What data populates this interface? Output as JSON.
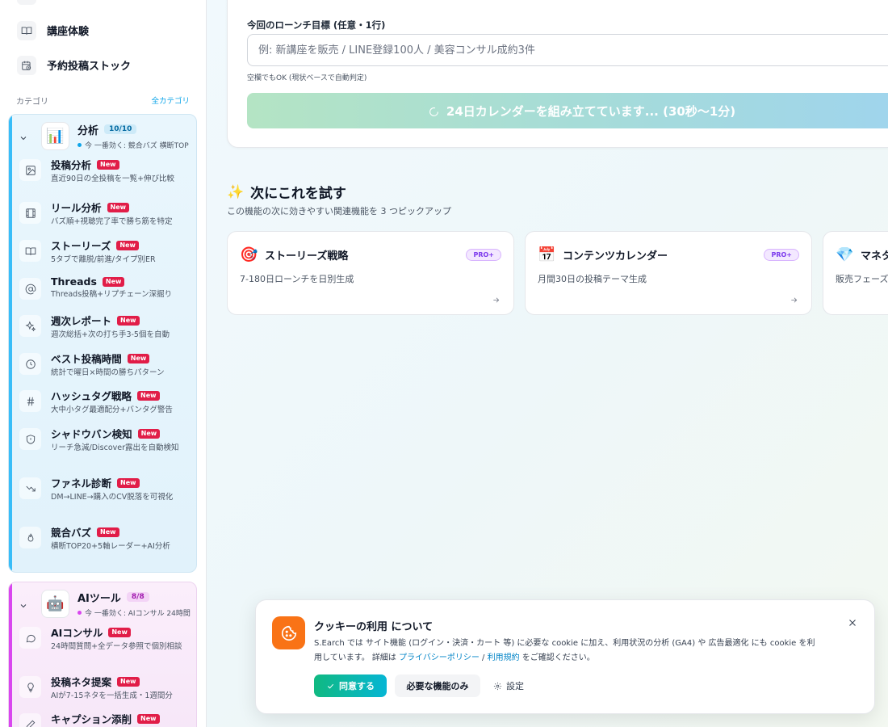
{
  "sidebar": {
    "top_items": [
      {
        "label": "講座体験",
        "icon": "book-open-icon"
      },
      {
        "label": "予約投稿ストック",
        "icon": "calendar-clock-icon"
      }
    ],
    "category_label": "カテゴリ",
    "all_categories_link": "全カテゴリ",
    "groups": [
      {
        "title": "分析",
        "count": "10/10",
        "subtitle": "今 一番効く: 競合バズ 横断TOP",
        "icon": "bar-chart-emoji",
        "accent": "#38bdf8",
        "items": [
          {
            "label": "投稿分析",
            "badge": "New",
            "desc": "直近90日の全投稿を一覧+伸び比較",
            "icon": "image-icon"
          },
          {
            "label": "リール分析",
            "badge": "New",
            "desc": "バズ順+視聴完了率で勝ち筋を特定",
            "icon": "film-icon"
          },
          {
            "label": "ストーリーズ",
            "badge": "New",
            "desc": "5タブで離脱/前進/タイプ別ER",
            "icon": "book-open-icon"
          },
          {
            "label": "Threads",
            "badge": "New",
            "desc": "Threads投稿+リプチェーン深掘り",
            "icon": "at-sign-icon"
          },
          {
            "label": "週次レポート",
            "badge": "New",
            "desc": "週次総括+次の打ち手3-5個を自動",
            "icon": "sparkles-icon"
          },
          {
            "label": "ベスト投稿時間",
            "badge": "New",
            "desc": "統計で曜日×時間の勝ちパターン",
            "icon": "clock-icon"
          },
          {
            "label": "ハッシュタグ戦略",
            "badge": "New",
            "desc": "大中小タグ最適配分+バンタグ警告",
            "icon": "hash-icon"
          },
          {
            "label": "シャドウバン検知",
            "badge": "New",
            "desc": "リーチ急減/Discover露出を自動検知",
            "icon": "shield-icon"
          },
          {
            "label": "ファネル診断",
            "badge": "New",
            "desc": "DM→LINE→購入のCV脱落を可視化",
            "icon": "trending-down-icon"
          },
          {
            "label": "競合バズ",
            "badge": "New",
            "desc": "横断TOP20+5軸レーダー+AI分析",
            "icon": "flame-icon"
          }
        ]
      },
      {
        "title": "AIツール",
        "count": "8/8",
        "subtitle": "今 一番効く: AIコンサル 24時間",
        "icon": "robot-emoji",
        "accent": "#d946ef",
        "items": [
          {
            "label": "AIコンサル",
            "badge": "New",
            "desc": "24時間質問+全データ参照で個別相談",
            "icon": "message-circle-icon"
          },
          {
            "label": "投稿ネタ提案",
            "badge": "New",
            "desc": "AIが7-15ネタを一括生成・1週間分",
            "icon": "lightbulb-icon"
          },
          {
            "label": "キャプション添削",
            "badge": "New",
            "desc": "",
            "icon": "edit-icon"
          }
        ]
      }
    ]
  },
  "main": {
    "form": {
      "label": "今回のローンチ目標 (任意・1行)",
      "placeholder": "例: 新講座を販売 / LINE登録100人 / 美容コンサル成約3件",
      "hint": "空欄でもOK (現状ベースで自動判定)",
      "button_label": "24日カレンダーを組み立てています... (30秒〜1分)"
    },
    "next": {
      "title": "次にこれを試す",
      "subtitle": "この機能の次に効きやすい関連機能を 3 つピックアップ",
      "cards": [
        {
          "emoji": "🎯",
          "title": "ストーリーズ戦略",
          "badge": "PRO+",
          "desc": "7-180日ローンチを日別生成"
        },
        {
          "emoji": "📅",
          "title": "コンテンツカレンダー",
          "badge": "PRO+",
          "desc": "月間30日の投稿テーマ生成"
        },
        {
          "emoji": "💎",
          "title": "マネタ",
          "badge": "",
          "desc": "販売フェーズ"
        }
      ]
    }
  },
  "cookie": {
    "title": "クッキーの利用 について",
    "body_part1": "S.Earch では サイト機能 (ログイン・決済・カート 等) に必要な cookie に加え、利用状況の分析 (GA4) や 広告最適化 にも cookie を利用しています。 詳細は ",
    "privacy_link": "プライバシーポリシー",
    "separator": " / ",
    "terms_link": "利用規約",
    "body_part2": " をご確認ください。",
    "accept_label": "同意する",
    "essential_label": "必要な機能のみ",
    "settings_label": "設定"
  },
  "colors": {
    "analysis_accent": "#38bdf8",
    "aitools_accent": "#d946ef",
    "new_badge": "#e11d48",
    "cookie_icon_bg": "#f97316"
  }
}
